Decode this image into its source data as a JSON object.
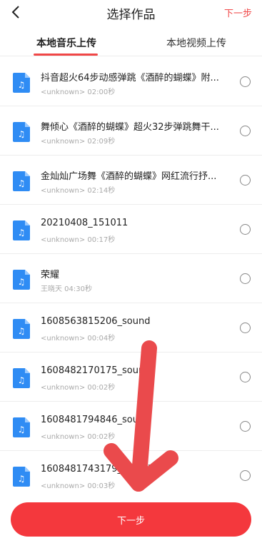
{
  "header": {
    "title": "选择作品",
    "next_label": "下一步"
  },
  "tabs": [
    {
      "label": "本地音乐上传",
      "active": true
    },
    {
      "label": "本地视频上传",
      "active": false
    }
  ],
  "items": [
    {
      "title": "抖音超火64步动感弹跳《酒醉的蝴蝶》附...",
      "subtitle": "<unknown> 02:00秒"
    },
    {
      "title": "舞倾心《酒醉的蝴蝶》超火32步弹跳舞干...",
      "subtitle": "<unknown> 02:09秒"
    },
    {
      "title": "金灿灿广场舞《酒醉的蝴蝶》网红流行抒...",
      "subtitle": "<unknown> 02:14秒"
    },
    {
      "title": "20210408_151011",
      "subtitle": "<unknown> 00:17秒"
    },
    {
      "title": "荣耀",
      "subtitle": "王晓天 04:30秒"
    },
    {
      "title": "1608563815206_sound",
      "subtitle": "<unknown> 00:04秒"
    },
    {
      "title": "1608482170175_sound",
      "subtitle": "<unknown> 00:02秒"
    },
    {
      "title": "1608481794846_sound",
      "subtitle": "<unknown> 00:02秒"
    },
    {
      "title": "1608481743179_sound",
      "subtitle": "<unknown> 00:03秒"
    }
  ],
  "bottom_button": {
    "label": "下一步"
  },
  "colors": {
    "accent": "#f04747",
    "button": "#f4383d",
    "icon_blue": "#2f8cf4",
    "arrow": "#ea4a4c"
  },
  "icons": {
    "back": "chevron-left-icon",
    "file": "music-file-icon",
    "radio": "radio-unchecked-icon",
    "overlay": "arrow-down-icon"
  }
}
